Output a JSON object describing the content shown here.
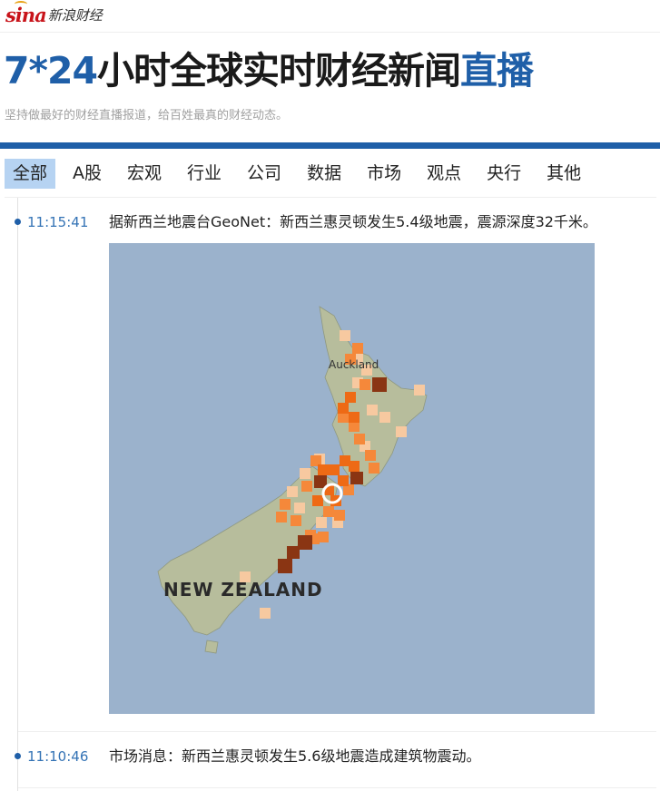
{
  "brand": {
    "logo_mark": "sina",
    "logo_text": "新浪财经"
  },
  "hero": {
    "title_prefix": "7*24",
    "title_middle": "小时全球实时财经新闻",
    "title_suffix": "直播",
    "subtitle": "坚持做最好的财经直播报道，给百姓最真的财经动态。"
  },
  "tabs": [
    {
      "label": "全部",
      "active": true
    },
    {
      "label": "A股"
    },
    {
      "label": "宏观"
    },
    {
      "label": "行业"
    },
    {
      "label": "公司"
    },
    {
      "label": "数据"
    },
    {
      "label": "市场"
    },
    {
      "label": "观点"
    },
    {
      "label": "央行"
    },
    {
      "label": "其他"
    }
  ],
  "feed": [
    {
      "time": "11:15:41",
      "text": "据新西兰地震台GeoNet：新西兰惠灵顿发生5.4级地震，震源深度32千米。",
      "map": {
        "label_city": "Auckland",
        "label_country": "NEW ZEALAND"
      }
    },
    {
      "time": "11:10:46",
      "text": "市场消息：新西兰惠灵顿发生5.6级地震造成建筑物震动。"
    }
  ],
  "colors": {
    "brand_blue": "#1f5fa8",
    "active_tab_bg": "#b6d3f2",
    "sea": "#9bb2cc",
    "land": "#b9bfa0",
    "intensity_light": "#f7c9a0",
    "intensity_mid": "#f5883a",
    "intensity_high": "#ee6a15",
    "intensity_severe": "#8a3513"
  },
  "icons": {
    "timeline_dot": "bullet-dot-icon",
    "epicenter": "epicenter-ring-icon"
  }
}
